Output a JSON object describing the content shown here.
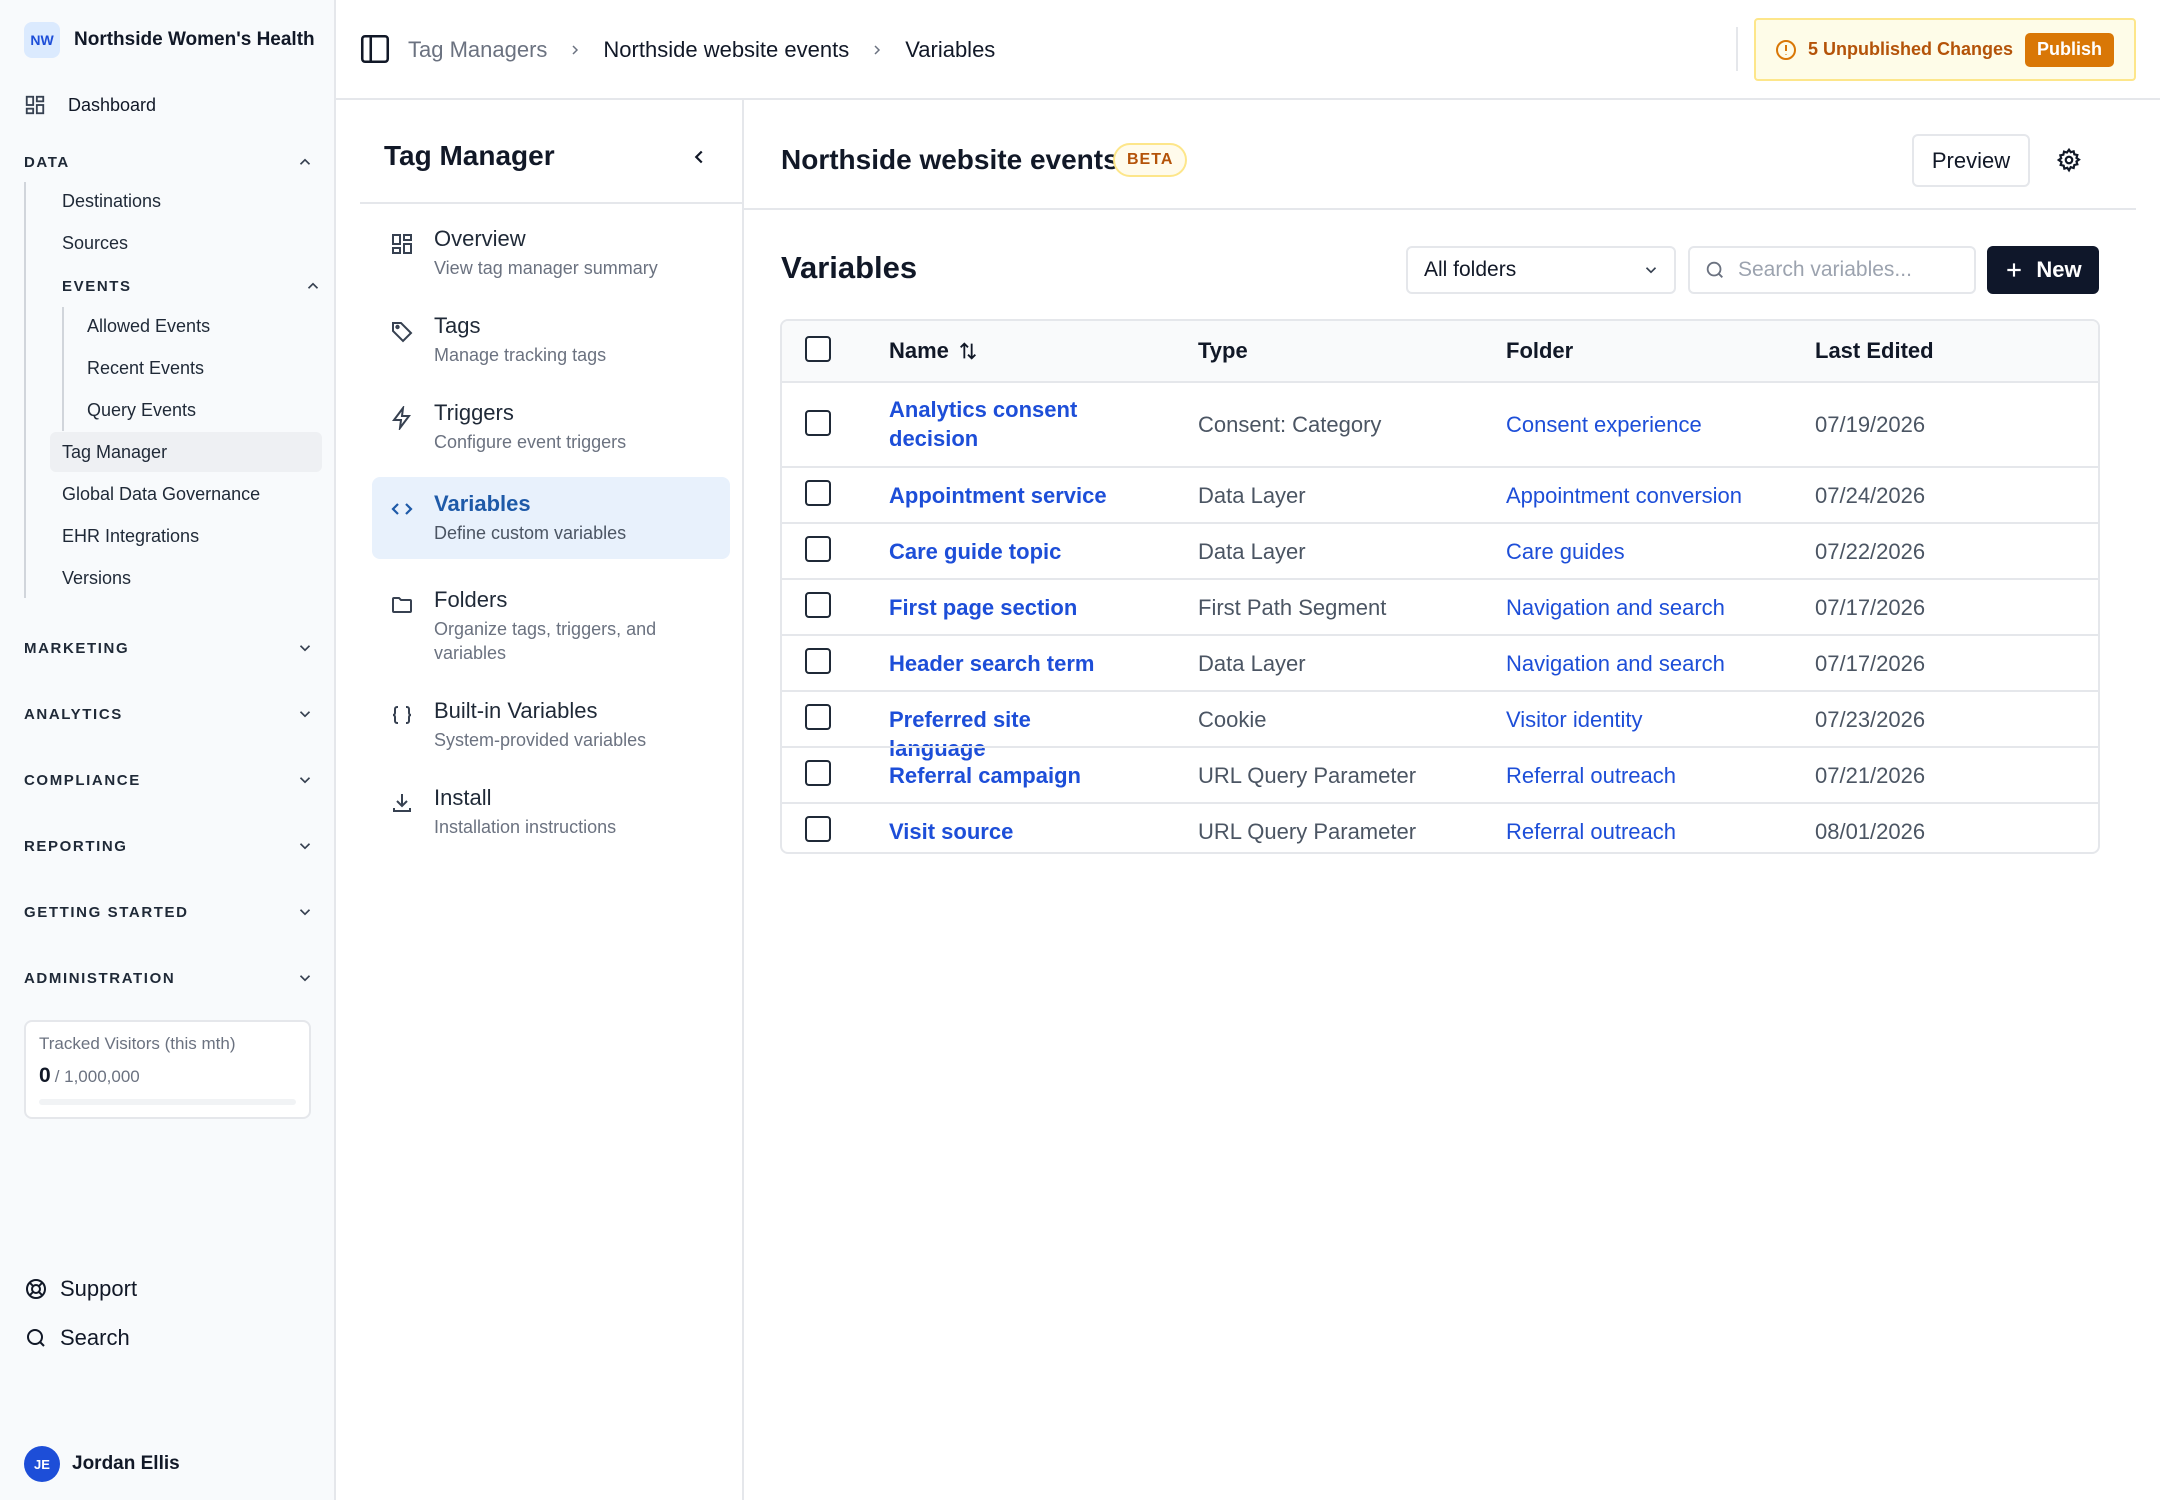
{
  "org": {
    "initials": "NW",
    "name": "Northside Women's Health"
  },
  "sidebar": {
    "dashboard": "Dashboard",
    "data_section": "DATA",
    "data_items": [
      "Destinations",
      "Sources"
    ],
    "events_section": "EVENTS",
    "events_items": [
      "Allowed Events",
      "Recent Events",
      "Query Events"
    ],
    "data_items_after": [
      "Tag Manager",
      "Global Data Governance",
      "EHR Integrations",
      "Versions"
    ],
    "active_item": "Tag Manager",
    "sections": [
      "MARKETING",
      "ANALYTICS",
      "COMPLIANCE",
      "REPORTING",
      "GETTING STARTED",
      "ADMINISTRATION"
    ],
    "usage": {
      "label": "Tracked Visitors (this mth)",
      "value": "0",
      "limit": "/ 1,000,000",
      "fraction": 0
    },
    "support": "Support",
    "search": "Search",
    "user": {
      "initials": "JE",
      "name": "Jordan Ellis"
    }
  },
  "topbar": {
    "breadcrumbs": [
      "Tag Managers",
      "Northside website events",
      "Variables"
    ],
    "unpublished": "5 Unpublished Changes",
    "publish": "Publish"
  },
  "tag_manager": {
    "title": "Tag Manager",
    "items": [
      {
        "name": "Overview",
        "desc": "View tag manager summary",
        "icon": "grid-icon"
      },
      {
        "name": "Tags",
        "desc": "Manage tracking tags",
        "icon": "tag-icon"
      },
      {
        "name": "Triggers",
        "desc": "Configure event triggers",
        "icon": "bolt-icon"
      },
      {
        "name": "Variables",
        "desc": "Define custom variables",
        "icon": "code-icon"
      },
      {
        "name": "Folders",
        "desc": "Organize tags, triggers, and variables",
        "icon": "folder-icon"
      },
      {
        "name": "Built-in Variables",
        "desc": "System-provided variables",
        "icon": "braces-icon"
      },
      {
        "name": "Install",
        "desc": "Installation instructions",
        "icon": "download-icon"
      }
    ],
    "active": "Variables"
  },
  "main": {
    "title": "Northside website events",
    "badge": "BETA",
    "preview": "Preview",
    "section_title": "Variables",
    "folder_filter": "All folders",
    "search_placeholder": "Search variables...",
    "new_button": "New",
    "columns": [
      "Name",
      "Type",
      "Folder",
      "Last Edited"
    ],
    "rows": [
      {
        "name": "Analytics consent decision",
        "type": "Consent: Category",
        "folder": "Consent experience",
        "date": "07/19/2026"
      },
      {
        "name": "Appointment service",
        "type": "Data Layer",
        "folder": "Appointment conversion",
        "date": "07/24/2026"
      },
      {
        "name": "Care guide topic",
        "type": "Data Layer",
        "folder": "Care guides",
        "date": "07/22/2026"
      },
      {
        "name": "First page section",
        "type": "First Path Segment",
        "folder": "Navigation and search",
        "date": "07/17/2026"
      },
      {
        "name": "Header search term",
        "type": "Data Layer",
        "folder": "Navigation and search",
        "date": "07/17/2026"
      },
      {
        "name": "Preferred site language",
        "type": "Cookie",
        "folder": "Visitor identity",
        "date": "07/23/2026"
      },
      {
        "name": "Referral campaign",
        "type": "URL Query Parameter",
        "folder": "Referral outreach",
        "date": "07/21/2026"
      },
      {
        "name": "Visit source",
        "type": "URL Query Parameter",
        "folder": "Referral outreach",
        "date": "08/01/2026"
      }
    ]
  },
  "colors": {
    "accent": "#1d4ed8",
    "active_bg": "#e8f1fc",
    "warning": "#d97706",
    "warning_bg": "#fefce8",
    "primary_button": "#0f172a"
  }
}
